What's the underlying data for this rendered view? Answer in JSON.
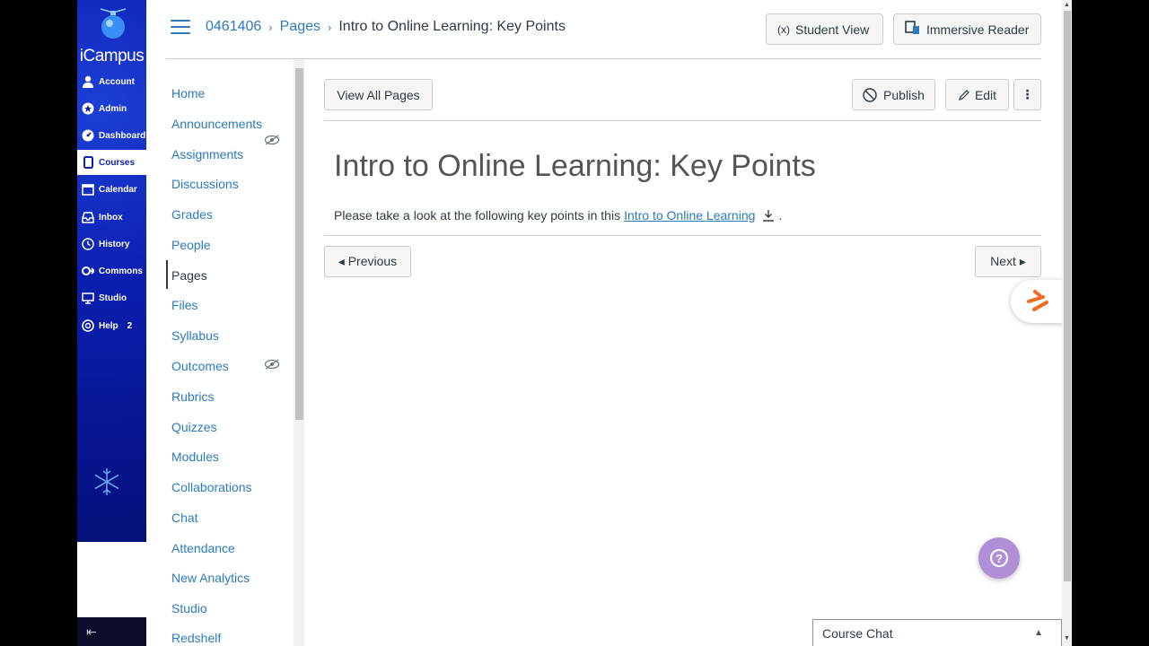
{
  "global_nav": {
    "logo": "iCampus",
    "items": [
      {
        "label": "Account",
        "icon": "user-icon"
      },
      {
        "label": "Admin",
        "icon": "shield-icon"
      },
      {
        "label": "Dashboard",
        "icon": "dashboard-icon"
      },
      {
        "label": "Courses",
        "icon": "book-icon",
        "active": true
      },
      {
        "label": "Calendar",
        "icon": "calendar-icon"
      },
      {
        "label": "Inbox",
        "icon": "inbox-icon"
      },
      {
        "label": "History",
        "icon": "clock-icon"
      },
      {
        "label": "Commons",
        "icon": "commons-icon"
      },
      {
        "label": "Studio",
        "icon": "studio-icon"
      },
      {
        "label": "Help",
        "icon": "help-icon",
        "badge": "2"
      }
    ],
    "collapse_icon": "collapse-arrow-icon"
  },
  "header": {
    "breadcrumb": [
      "0461406",
      "Pages",
      "Intro to Online Learning: Key Points"
    ],
    "student_view": "Student View",
    "immersive_reader": "Immersive Reader"
  },
  "course_nav": {
    "items": [
      {
        "label": "Home"
      },
      {
        "label": "Announcements",
        "hidden": true
      },
      {
        "label": "Assignments"
      },
      {
        "label": "Discussions"
      },
      {
        "label": "Grades"
      },
      {
        "label": "People"
      },
      {
        "label": "Pages",
        "active": true
      },
      {
        "label": "Files"
      },
      {
        "label": "Syllabus"
      },
      {
        "label": "Outcomes",
        "hidden": true
      },
      {
        "label": "Rubrics"
      },
      {
        "label": "Quizzes"
      },
      {
        "label": "Modules"
      },
      {
        "label": "Collaborations"
      },
      {
        "label": "Chat"
      },
      {
        "label": "Attendance"
      },
      {
        "label": "New Analytics"
      },
      {
        "label": "Studio"
      },
      {
        "label": "Redshelf"
      }
    ]
  },
  "toolbar": {
    "view_all_pages": "View All Pages",
    "publish": "Publish",
    "edit": "Edit",
    "more": "⋮"
  },
  "page": {
    "title": "Intro to Online Learning: Key Points",
    "body_prefix": "Please take a look at the following key points in this",
    "link_text": "Intro to Online Learning",
    "body_suffix": "."
  },
  "pager": {
    "previous": "◂ Previous",
    "next": "Next ▸"
  },
  "course_chat": {
    "label": "Course Chat",
    "caret": "▲"
  },
  "colors": {
    "link": "#2b7abc",
    "text": "#2d3b45",
    "nav_bg": "#0a1fb0",
    "help_fab": "#b08fd6"
  }
}
